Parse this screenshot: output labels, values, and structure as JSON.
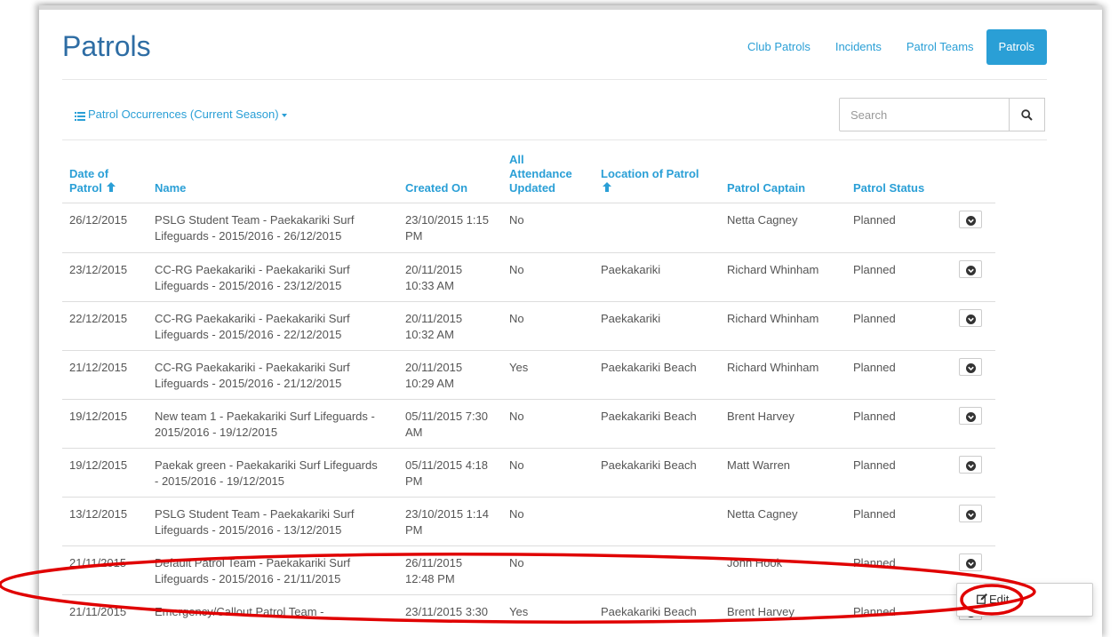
{
  "page": {
    "title": "Patrols"
  },
  "nav": {
    "items": [
      "Club Patrols",
      "Incidents",
      "Patrol Teams",
      "Patrols"
    ],
    "active": 3
  },
  "view_selector": {
    "label": "Patrol Occurrences (Current Season)"
  },
  "search": {
    "placeholder": "Search"
  },
  "table": {
    "headers": {
      "date": [
        "Date of",
        "Patrol"
      ],
      "name": "Name",
      "created": "Created On",
      "attendance": [
        "All",
        "Attendance",
        "Updated"
      ],
      "location": [
        "Location of Patrol"
      ],
      "captain": "Patrol Captain",
      "status": "Patrol Status"
    },
    "rows": [
      {
        "date": "26/12/2015",
        "name1": "PSLG Student Team - Paekakariki Surf",
        "name2": "Lifeguards - 2015/2016 - 26/12/2015",
        "created1": "23/10/2015 1:15",
        "created2": "PM",
        "attendance": "No",
        "location": "",
        "captain": "Netta Cagney",
        "status": "Planned"
      },
      {
        "date": "23/12/2015",
        "name1": "CC-RG Paekakariki - Paekakariki Surf",
        "name2": "Lifeguards - 2015/2016 - 23/12/2015",
        "created1": "20/11/2015",
        "created2": "10:33 AM",
        "attendance": "No",
        "location": "Paekakariki",
        "captain": "Richard Whinham",
        "status": "Planned"
      },
      {
        "date": "22/12/2015",
        "name1": "CC-RG Paekakariki - Paekakariki Surf",
        "name2": "Lifeguards - 2015/2016 - 22/12/2015",
        "created1": "20/11/2015",
        "created2": "10:32 AM",
        "attendance": "No",
        "location": "Paekakariki",
        "captain": "Richard Whinham",
        "status": "Planned"
      },
      {
        "date": "21/12/2015",
        "name1": "CC-RG Paekakariki - Paekakariki Surf",
        "name2": "Lifeguards - 2015/2016 - 21/12/2015",
        "created1": "20/11/2015",
        "created2": "10:29 AM",
        "attendance": "Yes",
        "location": "Paekakariki Beach",
        "captain": "Richard Whinham",
        "status": "Planned"
      },
      {
        "date": "19/12/2015",
        "name1": "New team 1 - Paekakariki Surf Lifeguards -",
        "name2": "2015/2016 - 19/12/2015",
        "created1": "05/11/2015 7:30",
        "created2": "AM",
        "attendance": "No",
        "location": "Paekakariki Beach",
        "captain": "Brent Harvey",
        "status": "Planned"
      },
      {
        "date": "19/12/2015",
        "name1": "Paekak green - Paekakariki Surf Lifeguards",
        "name2": "- 2015/2016 - 19/12/2015",
        "created1": "05/11/2015 4:18",
        "created2": "PM",
        "attendance": "No",
        "location": "Paekakariki Beach",
        "captain": "Matt Warren",
        "status": "Planned"
      },
      {
        "date": "13/12/2015",
        "name1": "PSLG Student Team - Paekakariki Surf",
        "name2": "Lifeguards - 2015/2016 - 13/12/2015",
        "created1": "23/10/2015 1:14",
        "created2": "PM",
        "attendance": "No",
        "location": "",
        "captain": "Netta Cagney",
        "status": "Planned"
      },
      {
        "date": "21/11/2015",
        "name1": "Default Patrol Team - Paekakariki Surf",
        "name2": "Lifeguards - 2015/2016 - 21/11/2015",
        "created1": "26/11/2015",
        "created2": "12:48 PM",
        "attendance": "No",
        "location": "",
        "captain": "John Hook",
        "status": "Planned"
      },
      {
        "date": "21/11/2015",
        "name1": "Emergency/Callout Patrol Team -",
        "name2": "",
        "created1": "23/11/2015 3:30",
        "created2": "",
        "attendance": "Yes",
        "location": "Paekakariki Beach",
        "captain": "Brent Harvey",
        "status": "Planned"
      }
    ]
  },
  "row_menu": {
    "edit_label": "Edit"
  },
  "colors": {
    "accent": "#2a9fd6",
    "title": "#2e6da4",
    "annotation": "#e00000"
  }
}
